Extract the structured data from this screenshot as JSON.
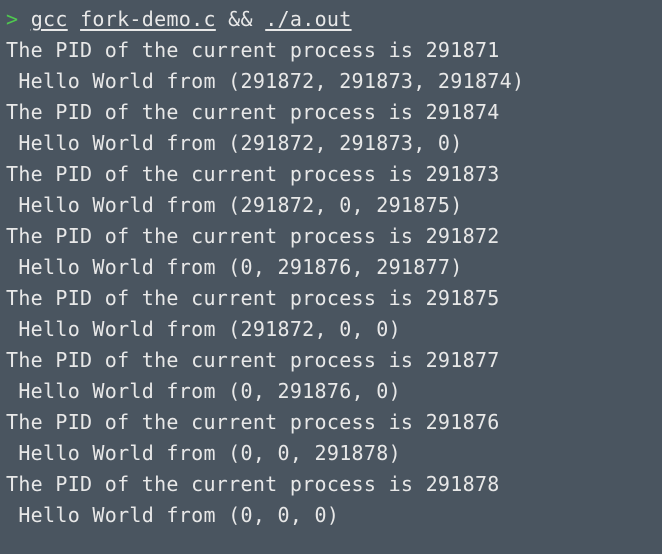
{
  "prompt": "> ",
  "command": {
    "part1": "gcc",
    "space1": " ",
    "part2": "fork-demo.c",
    "space2": " ",
    "part3": "&&",
    "space3": " ",
    "part4": "./a.out"
  },
  "output": [
    "The PID of the current process is 291871",
    " Hello World from (291872, 291873, 291874)",
    "The PID of the current process is 291874",
    " Hello World from (291872, 291873, 0)",
    "The PID of the current process is 291873",
    " Hello World from (291872, 0, 291875)",
    "The PID of the current process is 291872",
    " Hello World from (0, 291876, 291877)",
    "The PID of the current process is 291875",
    " Hello World from (291872, 0, 0)",
    "The PID of the current process is 291877",
    " Hello World from (0, 291876, 0)",
    "The PID of the current process is 291876",
    " Hello World from (0, 0, 291878)",
    "The PID of the current process is 291878",
    " Hello World from (0, 0, 0)"
  ]
}
